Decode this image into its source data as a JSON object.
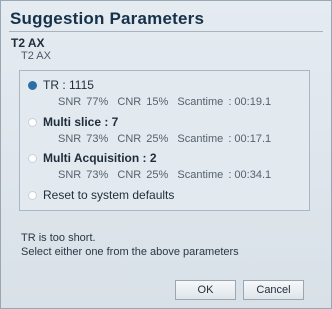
{
  "dialog": {
    "title": "Suggestion Parameters",
    "standard_label": "T2 AX",
    "standard_sub_label": "T2 AX"
  },
  "options": [
    {
      "label": "TR : 1115",
      "selected": true,
      "snr_label": "SNR",
      "snr_value": "77%",
      "cnr_label": "CNR",
      "cnr_value": "15%",
      "scantime_label": "Scantime",
      "scantime_value": ": 00:19.1"
    },
    {
      "label": "Multi slice : 7",
      "selected": false,
      "snr_label": "SNR",
      "snr_value": "73%",
      "cnr_label": "CNR",
      "cnr_value": "25%",
      "scantime_label": "Scantime",
      "scantime_value": ": 00:17.1"
    },
    {
      "label": "Multi Acquisition : 2",
      "selected": false,
      "snr_label": "SNR",
      "snr_value": "73%",
      "cnr_label": "CNR",
      "cnr_value": "25%",
      "scantime_label": "Scantime",
      "scantime_value": ": 00:34.1"
    }
  ],
  "reset_option": {
    "label": "Reset to system defaults",
    "selected": false
  },
  "message": {
    "line1": "TR is too short.",
    "line2": "Select either one from the above parameters"
  },
  "buttons": {
    "ok": "OK",
    "cancel": "Cancel"
  }
}
